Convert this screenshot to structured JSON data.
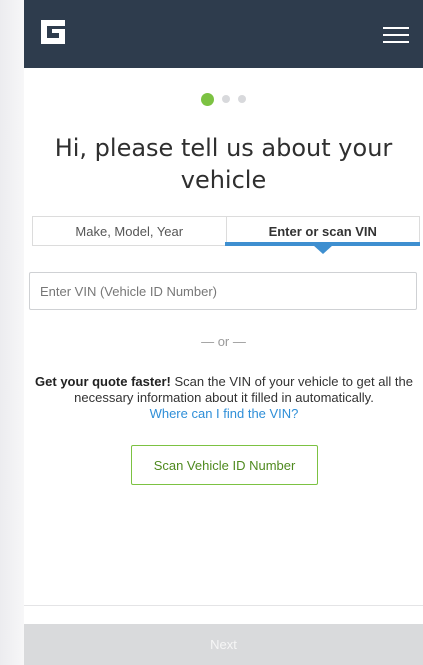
{
  "header": {
    "logo_icon": "brand-logo-icon",
    "menu_icon": "hamburger-menu-icon",
    "background_color": "#2e3c4d"
  },
  "progress": {
    "current_step": 1,
    "total_steps": 3,
    "active_color": "#7cc242"
  },
  "title": "Hi, please tell us about your vehicle",
  "tabs": [
    {
      "label": "Make, Model, Year",
      "active": false
    },
    {
      "label": "Enter or scan VIN",
      "active": true
    }
  ],
  "vin_input": {
    "placeholder": "Enter VIN (Vehicle ID Number)",
    "value": ""
  },
  "separator": "— or —",
  "info": {
    "bold_text": "Get your quote faster!",
    "text": " Scan the VIN of your vehicle to get all the necessary information about it filled in automatically.",
    "link_text": "Where can I find the VIN?"
  },
  "scan_button": {
    "label": "Scan Vehicle ID Number"
  },
  "next_button": {
    "label": "Next"
  },
  "colors": {
    "accent_blue": "#3e8fd0",
    "link_blue": "#2f8fd8",
    "green": "#7cc242"
  }
}
